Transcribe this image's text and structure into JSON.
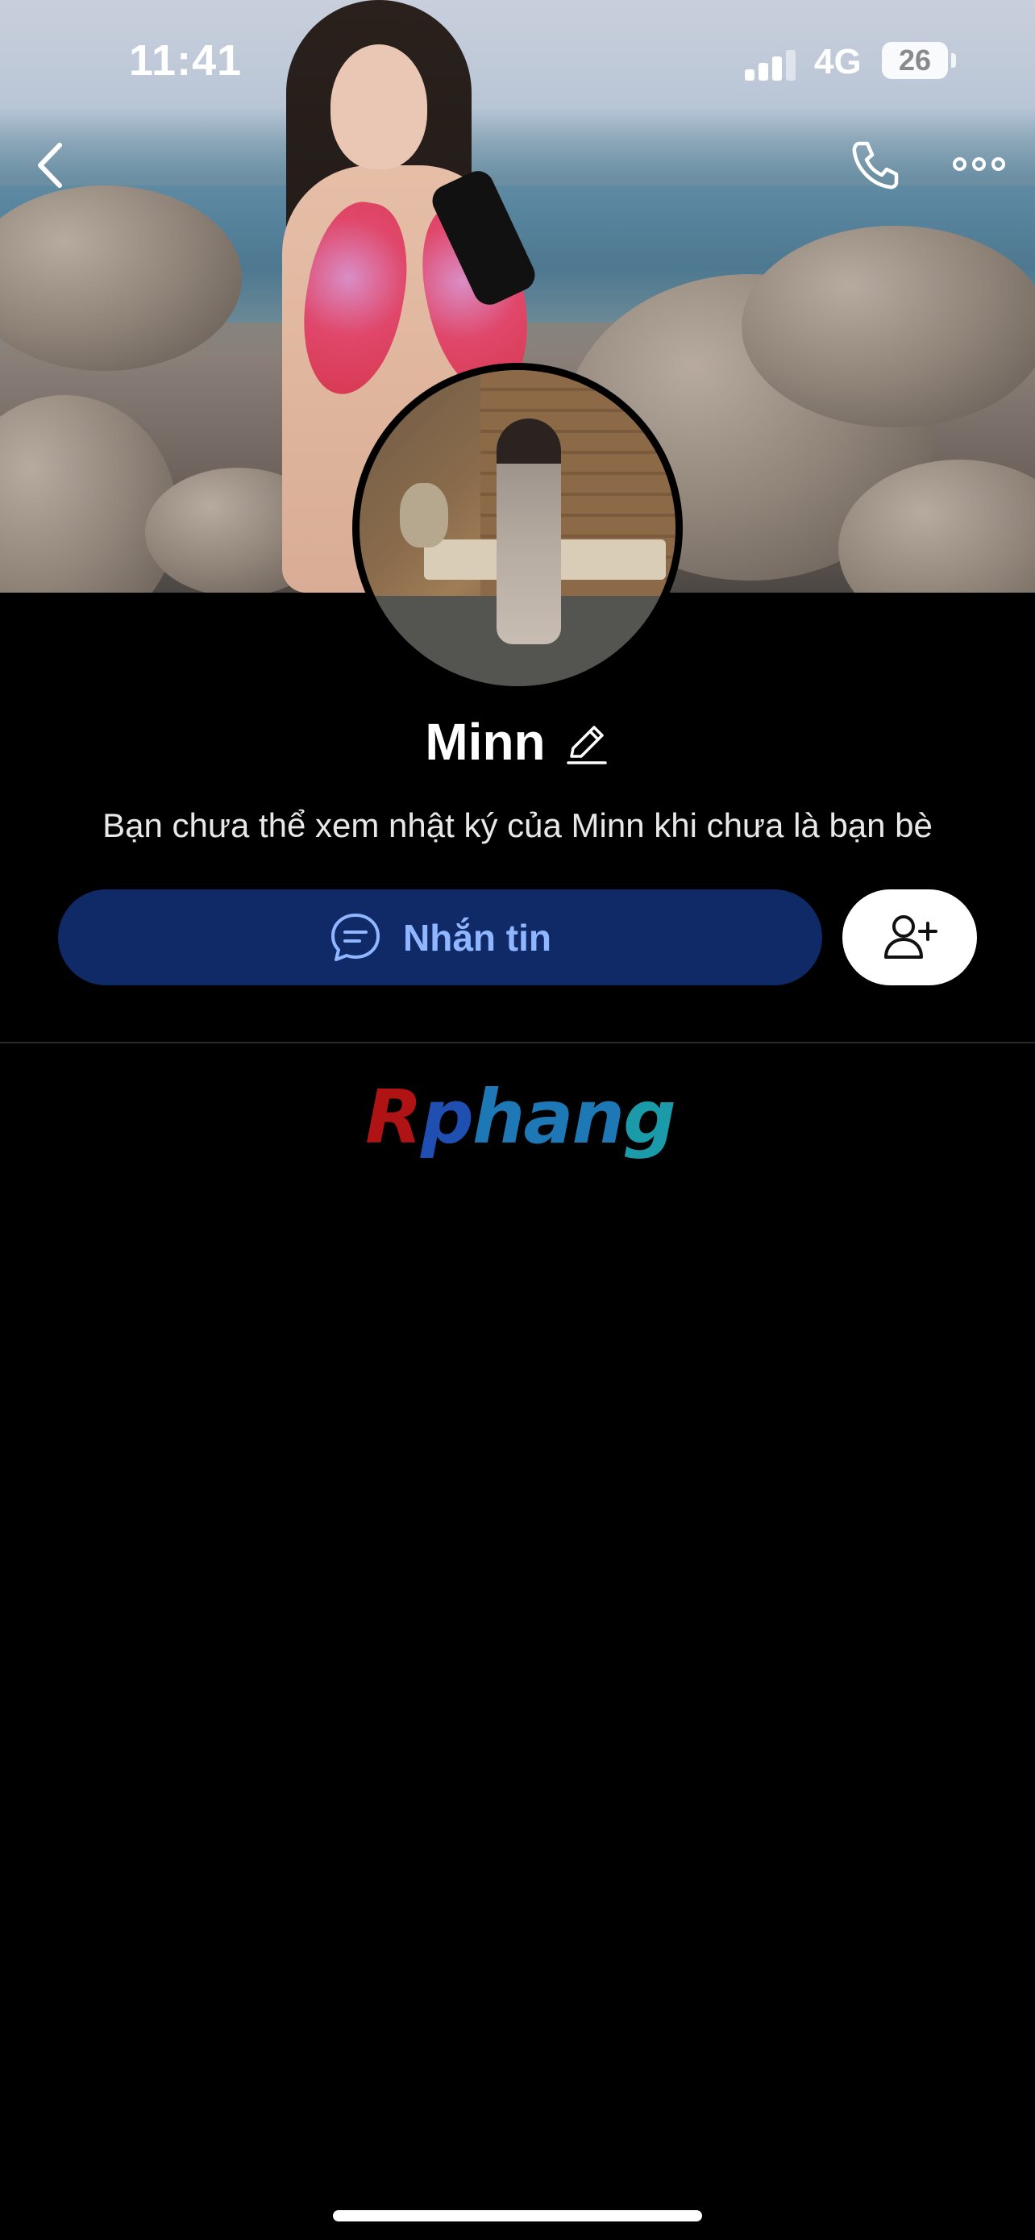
{
  "status_bar": {
    "time": "11:41",
    "network": "4G",
    "battery": "26"
  },
  "profile": {
    "name": "Minn",
    "notice": "Bạn chưa thể xem nhật ký của Minn khi chưa là bạn bè"
  },
  "actions": {
    "message_label": "Nhắn tin"
  },
  "logo": {
    "part1": "R",
    "part2": "p",
    "part3": "han",
    "part4": "g"
  },
  "icons": {
    "back": "chevron-left-icon",
    "call": "phone-icon",
    "more": "more-dots-icon",
    "edit": "pencil-icon",
    "message": "chat-bubble-icon",
    "add_friend": "add-friend-icon"
  },
  "colors": {
    "background": "#000000",
    "message_button": "#0f2a66",
    "message_text": "#8fb6ff",
    "add_button": "#ffffff"
  }
}
